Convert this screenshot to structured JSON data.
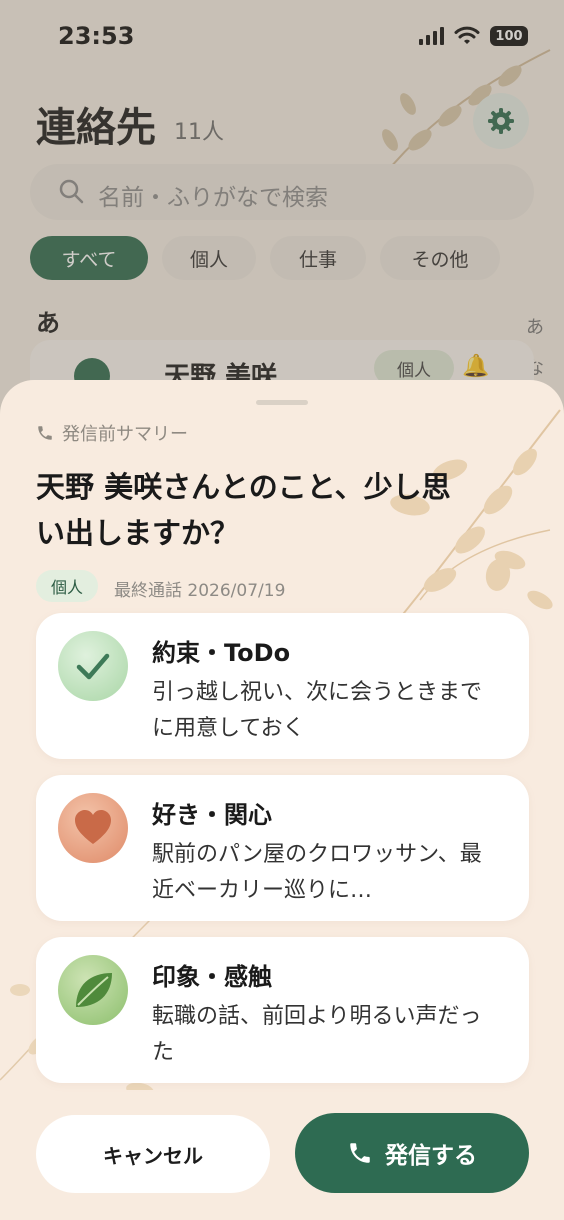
{
  "status_bar": {
    "time": "23:53",
    "battery": "100"
  },
  "background": {
    "title": "連絡先",
    "count": "11人",
    "search_placeholder": "名前・ふりがなで検索",
    "chips": [
      "すべて",
      "個人",
      "仕事",
      "その他"
    ],
    "section": "あ",
    "index_letters": [
      "あ",
      "な"
    ],
    "row": {
      "name": "天野 美咲",
      "tag": "個人"
    }
  },
  "sheet": {
    "label": "発信前サマリー",
    "title": "天野 美咲さんとのこと、少し思い出しますか？",
    "tag": "個人",
    "last_call": "最終通話 2026/07/19",
    "cards": [
      {
        "icon": "check-icon",
        "title": "約束・ToDo",
        "body": "引っ越し祝い、次に会うときまでに用意しておく"
      },
      {
        "icon": "heart-icon",
        "title": "好き・関心",
        "body": "駅前のパン屋のクロワッサン、最近ベーカリー巡りに…"
      },
      {
        "icon": "leaf-icon",
        "title": "印象・感触",
        "body": "転職の話、前回より明るい声だった"
      }
    ],
    "cancel_label": "キャンセル",
    "call_label": "発信する"
  },
  "colors": {
    "accent": "#2e6b52",
    "sheet_bg": "#f8ebdf",
    "tag_bg": "#e3eedf"
  }
}
